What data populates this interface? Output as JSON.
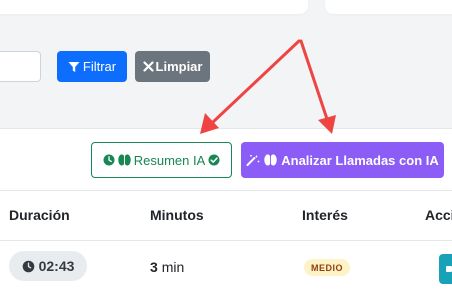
{
  "filters": {
    "search_placeholder": "",
    "filter_label": "Filtrar",
    "clear_label": "Limpiar"
  },
  "actions": {
    "summary_label": "Resumen IA",
    "analyze_label": "Analizar Llamadas con IA"
  },
  "table": {
    "headers": {
      "duration": "Duración",
      "minutes": "Minutos",
      "interest": "Interés",
      "actions": "Acci"
    },
    "rows": [
      {
        "duration": "02:43",
        "minutes_value": "3",
        "minutes_unit": "min",
        "interest": "MEDIO"
      }
    ]
  },
  "icons": {
    "filter": "filter-icon",
    "clear": "x-icon",
    "clock": "clock-icon",
    "brain": "brain-icon",
    "check": "check-circle-icon",
    "wand": "magic-wand-icon",
    "stopwatch": "stopwatch-icon"
  },
  "colors": {
    "primary": "#0d6efd",
    "secondary": "#6c757d",
    "success": "#198754",
    "purple": "#8b5cf6",
    "badge_bg": "#fef3c7",
    "badge_fg": "#92400e",
    "arrow": "#ef4444",
    "info": "#17a2b8"
  }
}
